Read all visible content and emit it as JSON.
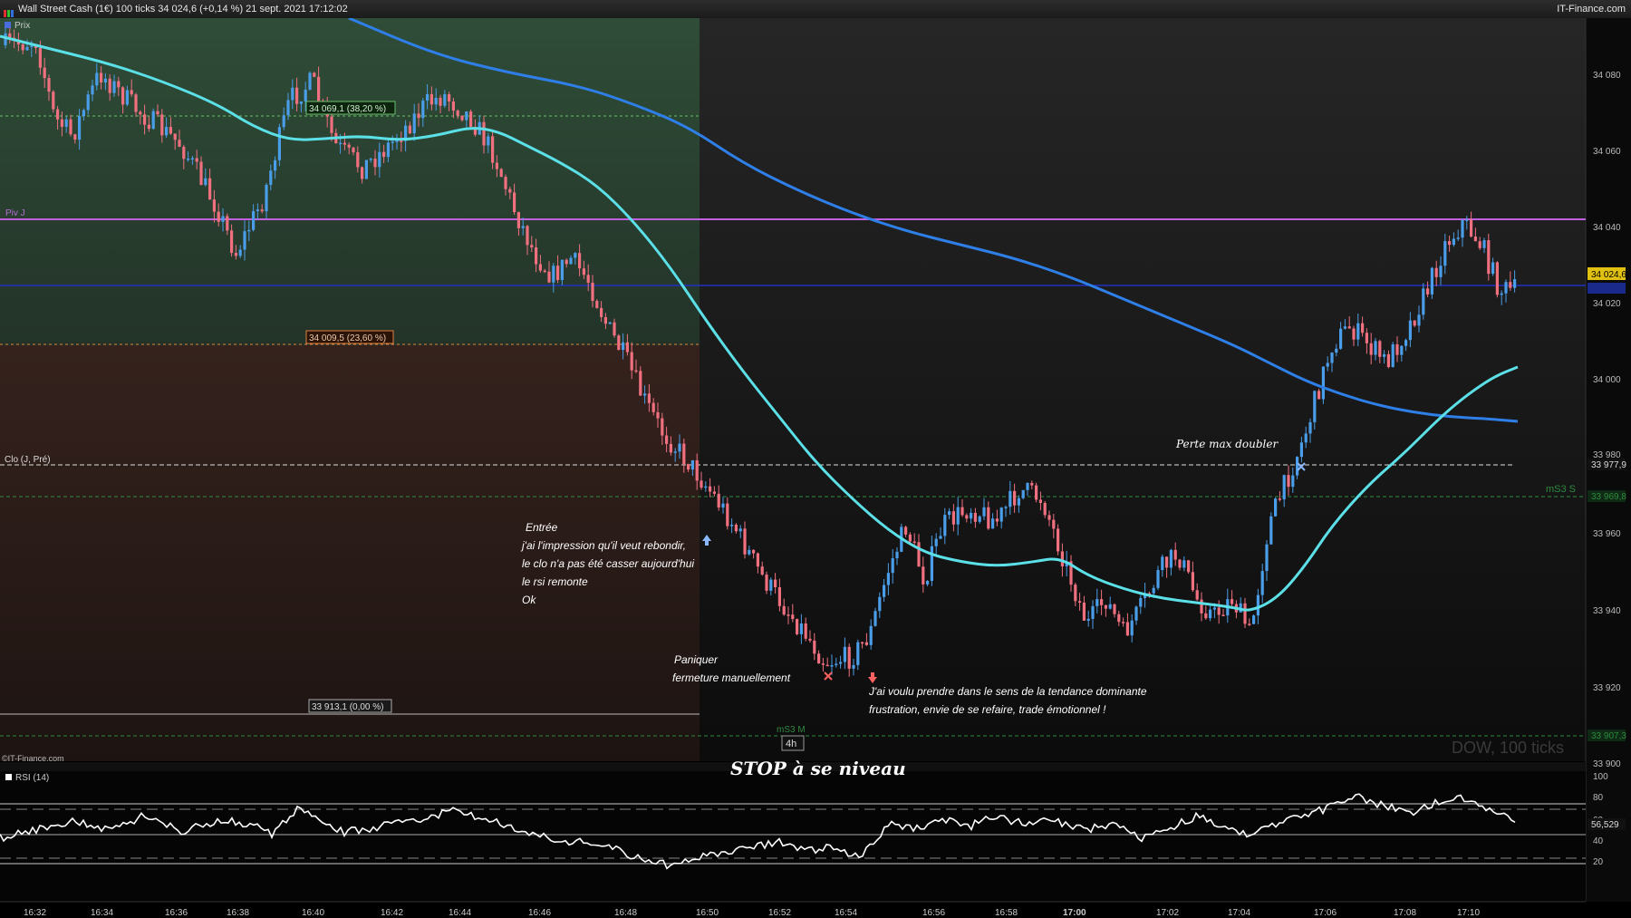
{
  "window": {
    "title": "Wall Street Cash (1€) 100 ticks 34 024,6 (+0,14 %) 21 sept. 2021 17:12:02",
    "brand": "IT-Finance.com"
  },
  "main_chart": {
    "legend_label": "Prix",
    "watermark": "DOW, 100 ticks",
    "price_axis": [
      "34 080",
      "34 060",
      "34 040",
      "34 020",
      "34 000",
      "33 980",
      "33 960",
      "33 940",
      "33 920",
      "33 900"
    ],
    "current_price_tag": "34 024,6",
    "levels": {
      "fib_38": "34 069,1 (38,20 %)",
      "fib_23": "34 009,5 (23,60 %)",
      "fib_0": "33 913,1 (0,00 %)",
      "pivot_label": "Piv J",
      "close_label": "Clo (J, Pré)",
      "close_value": "33 977,9",
      "ms3s_label": "mS3 S",
      "ms3s_value": "33 969,8",
      "ms3m_label": "mS3 M",
      "ms3m_value": "33 907,3"
    },
    "timeframe_badge": "4h",
    "colors": {
      "up_candle": "#4a9de8",
      "down_candle": "#f07080",
      "ma_fast": "#5ce0e8",
      "ma_slow": "#2f7fe8",
      "pivot_line": "#c060e0",
      "price_line": "#2030c0"
    }
  },
  "annotations": {
    "entree": [
      "Entrée",
      "j'ai l'impression qu'il veut rebondir,",
      "le clo n'a pas été casser aujourd'hui",
      "le rsi remonte",
      "Ok"
    ],
    "paniquer": [
      "Paniquer",
      "fermeture manuellement"
    ],
    "voulu": [
      "J'ai voulu prendre dans  le sens de la tendance dominante",
      "frustration, envie de se refaire, trade émotionnel !"
    ],
    "perte": "Perte max doubler",
    "stop": "STOP à se niveau"
  },
  "rsi_panel": {
    "source_label": "©IT-Finance.com",
    "legend_label": "RSI (14)",
    "axis": [
      "100",
      "80",
      "60",
      "40",
      "20"
    ],
    "current_value": "56,529"
  },
  "time_axis": [
    "16:32",
    "16:34",
    "16:36",
    "16:38",
    "16:40",
    "16:42",
    "16:44",
    "16:46",
    "16:48",
    "16:50",
    "16:52",
    "16:54",
    "16:56",
    "16:58",
    "17:00",
    "17:02",
    "17:04",
    "17:06",
    "17:08",
    "17:10"
  ]
}
